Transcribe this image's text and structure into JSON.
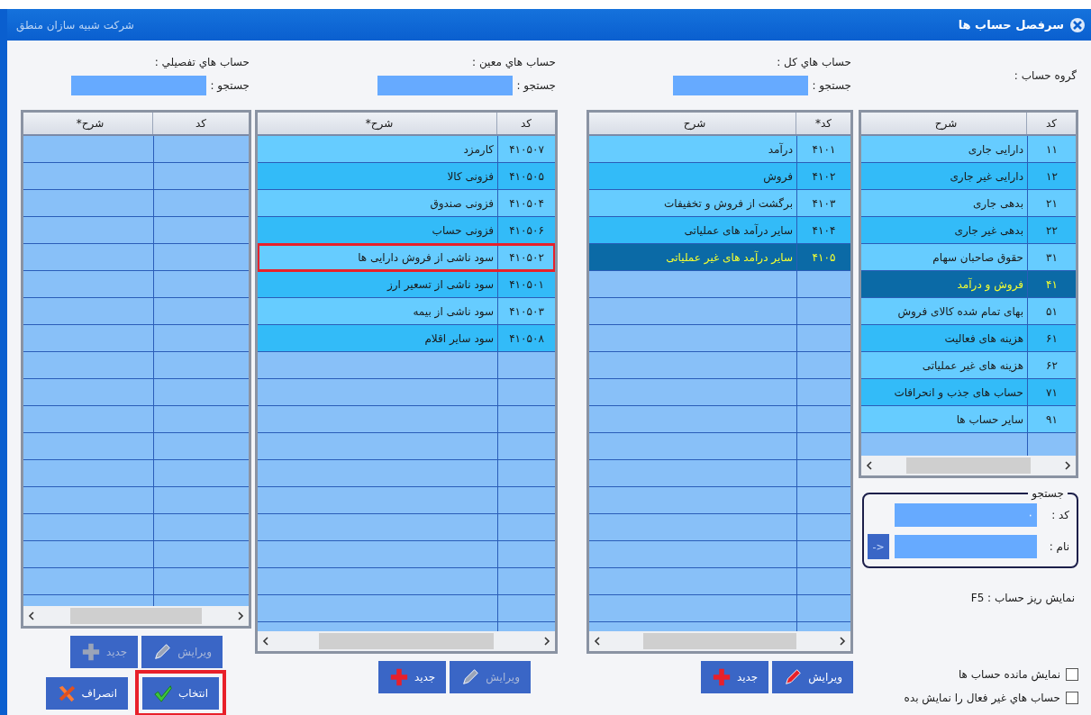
{
  "window": {
    "title": "سرفصل حساب ها",
    "company": "شرکت شبیه سازان منطق"
  },
  "group": {
    "label": "گروه حساب :",
    "columns": [
      "کد",
      "شرح"
    ],
    "rows": [
      {
        "code": "۱۱",
        "name": "دارایی جاری",
        "selected": false
      },
      {
        "code": "۱۲",
        "name": "دارایی غیر جاری",
        "selected": false
      },
      {
        "code": "۲۱",
        "name": "بدهی جاری",
        "selected": false
      },
      {
        "code": "۲۲",
        "name": "بدهی غیر جاری",
        "selected": false
      },
      {
        "code": "۳۱",
        "name": "حقوق صاحبان سهام",
        "selected": false
      },
      {
        "code": "۴۱",
        "name": "فروش و درآمد",
        "selected": true
      },
      {
        "code": "۵۱",
        "name": "بهای تمام شده کالای فروش",
        "selected": false
      },
      {
        "code": "۶۱",
        "name": "هزینه های فعالیت",
        "selected": false
      },
      {
        "code": "۶۲",
        "name": "هزینه های غیر عملیاتی",
        "selected": false
      },
      {
        "code": "۷۱",
        "name": "حساب های جذب و انحرافات",
        "selected": false
      },
      {
        "code": "۹۱",
        "name": "سایر حساب ها",
        "selected": false
      }
    ],
    "search": {
      "legend": "جستجو",
      "code_label": "کد :",
      "code_value": "۰",
      "name_label": "نام :",
      "go_button": "<-"
    },
    "hint": "F5 : نمایش ریز حساب",
    "options": [
      {
        "label": "نمایش مانده حساب ها",
        "checked": false
      },
      {
        "label": "حساب هاي غير فعال را نمايش بده",
        "checked": false
      }
    ]
  },
  "general": {
    "label": "حساب هاي کل :",
    "search_label": "جستجو :",
    "columns": [
      "کد*",
      "شرح"
    ],
    "rows": [
      {
        "code": "۴۱۰۱",
        "name": "درآمد",
        "selected": false,
        "highlighted": false
      },
      {
        "code": "۴۱۰۲",
        "name": "فروش",
        "selected": false,
        "highlighted": false
      },
      {
        "code": "۴۱۰۳",
        "name": "برگشت از فروش و تخفیفات",
        "selected": false,
        "highlighted": false
      },
      {
        "code": "۴۱۰۴",
        "name": "سایر درآمد های عملیاتی",
        "selected": false,
        "highlighted": false
      },
      {
        "code": "۴۱۰۵",
        "name": "سایر درآمد های غیر عملیاتی",
        "selected": true,
        "highlighted": false
      }
    ],
    "buttons": [
      {
        "kind": "edit",
        "label": "ویرایش",
        "disabled": false
      },
      {
        "kind": "new",
        "label": "جدید",
        "disabled": false
      }
    ]
  },
  "subsidiary": {
    "label": "حساب هاي معين :",
    "search_label": "جستجو :",
    "columns": [
      "کد",
      "شرح*"
    ],
    "rows": [
      {
        "code": "۴۱۰۵۰۷",
        "name": "کارمزد",
        "selected": false,
        "highlighted": false
      },
      {
        "code": "۴۱۰۵۰۵",
        "name": "فزونی کالا",
        "selected": false,
        "highlighted": false
      },
      {
        "code": "۴۱۰۵۰۴",
        "name": "فزونی صندوق",
        "selected": false,
        "highlighted": false
      },
      {
        "code": "۴۱۰۵۰۶",
        "name": "فزونی حساب",
        "selected": false,
        "highlighted": false
      },
      {
        "code": "۴۱۰۵۰۲",
        "name": "سود ناشی از فروش دارایی ها",
        "selected": false,
        "highlighted": true
      },
      {
        "code": "۴۱۰۵۰۱",
        "name": "سود ناشی از تسعیر ارز",
        "selected": false,
        "highlighted": false
      },
      {
        "code": "۴۱۰۵۰۳",
        "name": "سود ناشی از بیمه",
        "selected": false,
        "highlighted": false
      },
      {
        "code": "۴۱۰۵۰۸",
        "name": "سود سایر اقلام",
        "selected": false,
        "highlighted": false
      }
    ],
    "buttons": [
      {
        "kind": "edit",
        "label": "ویرایش",
        "disabled": true
      },
      {
        "kind": "new",
        "label": "جدید",
        "disabled": false
      }
    ]
  },
  "detail": {
    "label": "حساب هاي تفصيلي :",
    "search_label": "جستجو :",
    "columns": [
      "کد",
      "شرح*"
    ],
    "buttons": [
      {
        "kind": "edit",
        "label": "ویرایش",
        "disabled": true
      },
      {
        "kind": "new",
        "label": "جدید",
        "disabled": true
      }
    ]
  },
  "actions": [
    {
      "kind": "select",
      "label": "انتخاب",
      "highlighted": true
    },
    {
      "kind": "cancel",
      "label": "انصراف",
      "highlighted": false
    }
  ]
}
